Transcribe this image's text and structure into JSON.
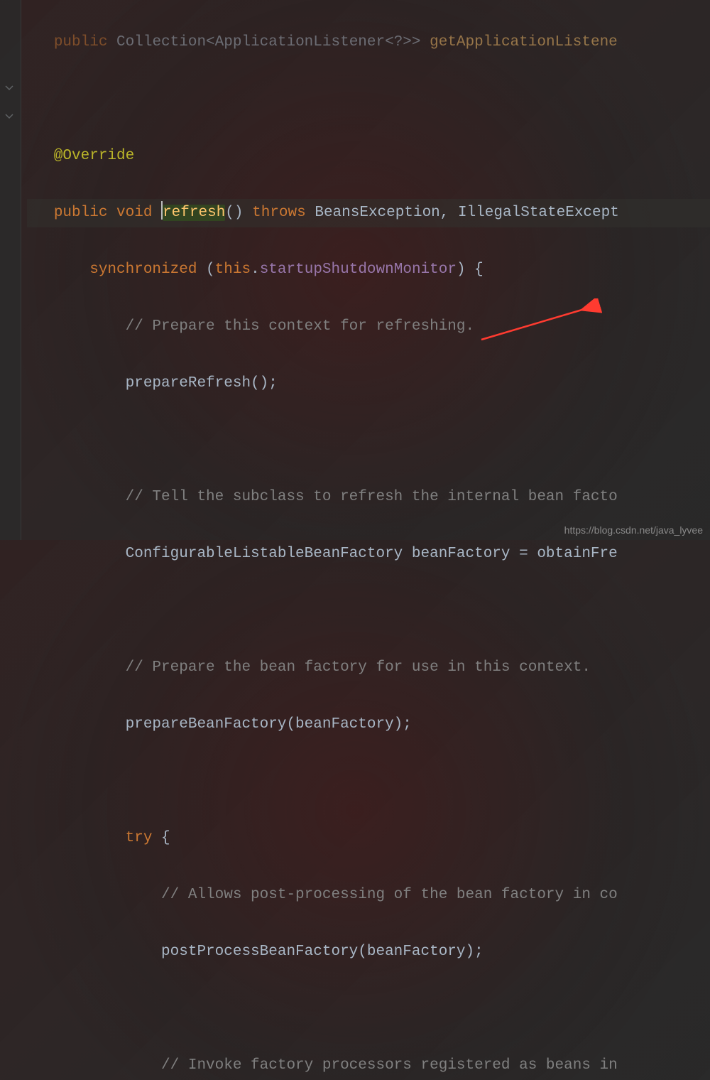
{
  "code": {
    "line1_pre": "   ",
    "line1_kw": "public",
    "line1_mid": " Collection<ApplicationListener<?>> ",
    "line1_method": "getApplicationListene",
    "blank": "",
    "annotation": "   @Override",
    "line4_indent": "   ",
    "line4_kw1": "public",
    "line4_sp1": " ",
    "line4_kw2": "void",
    "line4_sp2": " ",
    "line4_method": "refresh",
    "line4_paren": "() ",
    "line4_kw3": "throws",
    "line4_sp3": " ",
    "line4_ex1": "BeansException",
    "line4_comma": ", ",
    "line4_ex2": "IllegalStateExcept",
    "line5_indent": "       ",
    "line5_kw": "synchronized",
    "line5_sp": " (",
    "line5_kw2": "this",
    "line5_dot": ".",
    "line5_field": "startupShutdownMonitor",
    "line5_end": ") {",
    "comment1": "           // Prepare this context for refreshing.",
    "line7": "           prepareRefresh();",
    "comment2": "           // Tell the subclass to refresh the internal bean facto",
    "line10": "           ConfigurableListableBeanFactory beanFactory = obtainFre",
    "comment3": "           // Prepare the bean factory for use in this context.",
    "line13": "           prepareBeanFactory(beanFactory);",
    "line15_indent": "           ",
    "line15_kw": "try",
    "line15_end": " {",
    "comment4": "               // Allows post-processing of the bean factory in co",
    "line17": "               postProcessBeanFactory(beanFactory);",
    "comment5": "               // Invoke factory processors registered as beans in"
  },
  "watermark": "https://blog.csdn.net/java_lyvee"
}
